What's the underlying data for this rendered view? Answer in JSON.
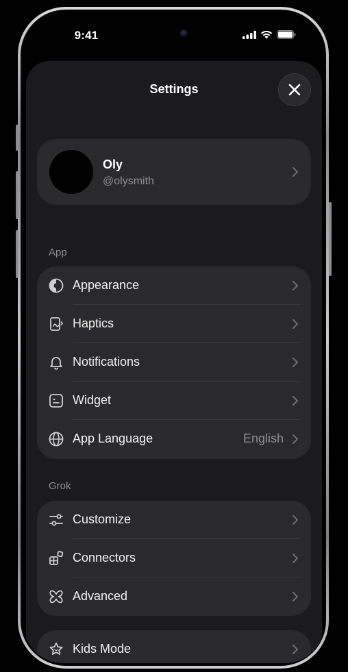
{
  "status": {
    "time": "9:41"
  },
  "header": {
    "title": "Settings"
  },
  "profile": {
    "name": "Oly",
    "handle": "@olysmith"
  },
  "sections": {
    "app": {
      "label": "App",
      "items": [
        {
          "label": "Appearance",
          "icon": "appearance-icon"
        },
        {
          "label": "Haptics",
          "icon": "haptics-icon"
        },
        {
          "label": "Notifications",
          "icon": "bell-icon"
        },
        {
          "label": "Widget",
          "icon": "widget-icon"
        },
        {
          "label": "App Language",
          "icon": "globe-icon",
          "value": "English"
        }
      ]
    },
    "grok": {
      "label": "Grok",
      "items": [
        {
          "label": "Customize",
          "icon": "sliders-icon"
        },
        {
          "label": "Connectors",
          "icon": "connectors-icon"
        },
        {
          "label": "Advanced",
          "icon": "advanced-icon"
        }
      ]
    },
    "other": {
      "items": [
        {
          "label": "Kids Mode",
          "icon": "kids-mode-icon"
        }
      ]
    }
  },
  "colors": {
    "sheet": "#1b1b1d",
    "card": "#2a2a2c",
    "secondary_text": "#8e8e93"
  }
}
